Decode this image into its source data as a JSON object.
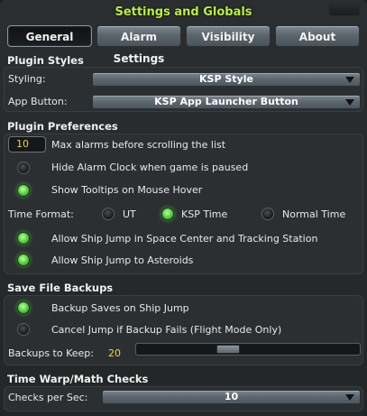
{
  "window": {
    "title": "Settings and Globals"
  },
  "tabs": [
    {
      "label": "General",
      "active": true
    },
    {
      "label": "Alarm Settings",
      "active": false
    },
    {
      "label": "Visibility",
      "active": false
    },
    {
      "label": "About",
      "active": false
    }
  ],
  "plugin_styles": {
    "heading": "Plugin Styles",
    "styling_label": "Styling:",
    "styling_value": "KSP Style",
    "app_button_label": "App Button:",
    "app_button_value": "KSP App Launcher Button"
  },
  "plugin_preferences": {
    "heading": "Plugin Preferences",
    "max_alarms_value": "10",
    "max_alarms_label": "Max alarms before scrolling the list",
    "hide_alarm_label": "Hide Alarm Clock when game is paused",
    "hide_alarm_checked": false,
    "tooltips_label": "Show Tooltips on Mouse Hover",
    "tooltips_checked": true,
    "time_format_label": "Time Format:",
    "time_format_options": [
      "UT",
      "KSP Time",
      "Normal Time"
    ],
    "time_format_selected": "KSP Time",
    "ship_jump_sc_label": "Allow Ship Jump in Space Center and Tracking Station",
    "ship_jump_sc_checked": true,
    "ship_jump_ast_label": "Allow Ship Jump to Asteroids",
    "ship_jump_ast_checked": true
  },
  "save_file_backups": {
    "heading": "Save File Backups",
    "backup_on_jump_label": "Backup Saves on Ship Jump",
    "backup_on_jump_checked": true,
    "cancel_jump_label": "Cancel Jump if Backup Fails (Flight Mode Only)",
    "cancel_jump_checked": false,
    "backups_to_keep_label": "Backups to Keep:",
    "backups_to_keep_value": "20",
    "backups_to_keep_slider_fraction": 0.4
  },
  "time_warp": {
    "heading": "Time Warp/Math Checks",
    "checks_label": "Checks per Sec:",
    "checks_value": "10"
  },
  "colors": {
    "accent_green": "#b9f23c",
    "value_yellow": "#f4d23c",
    "toggle_on": "#5cd84b"
  }
}
